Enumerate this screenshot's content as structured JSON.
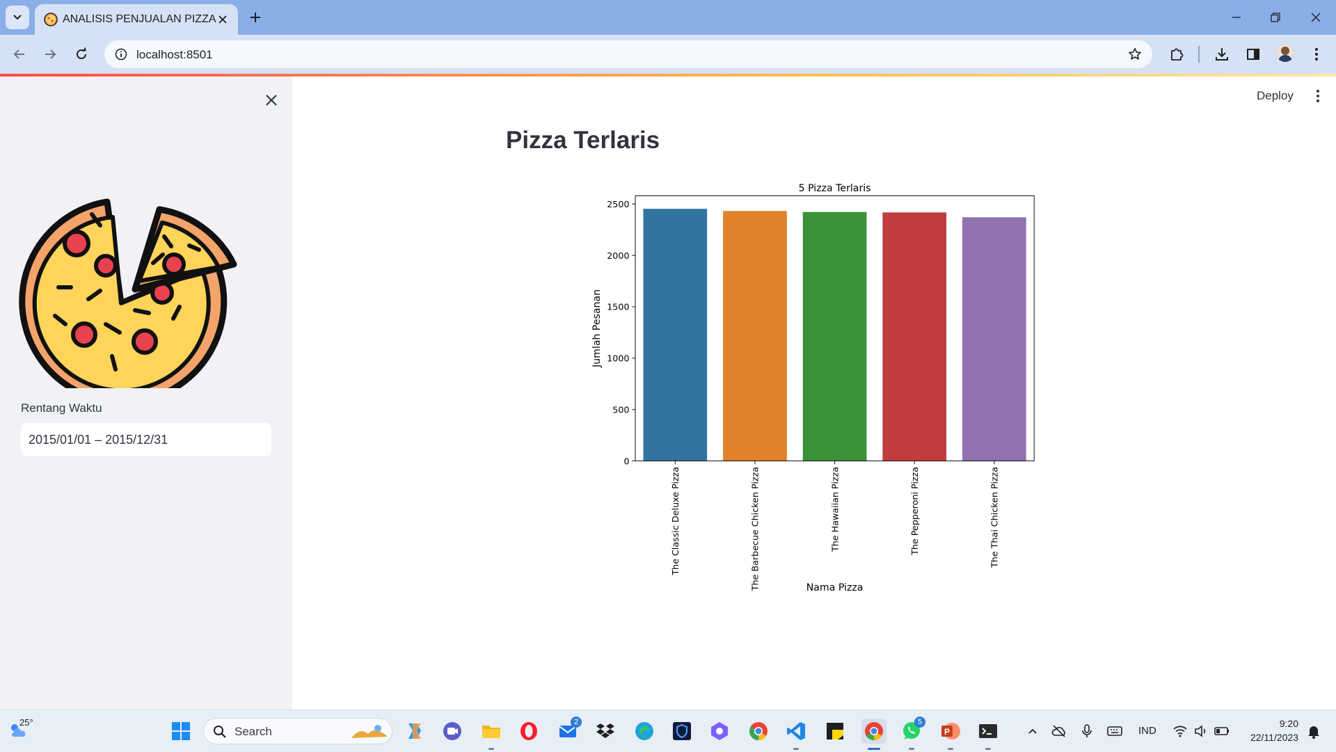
{
  "browser": {
    "tab_title": "ANALISIS PENJUALAN PIZZA",
    "url": "localhost:8501"
  },
  "sidebar": {
    "date_label": "Rentang Waktu",
    "date_value": "2015/01/01 – 2015/12/31"
  },
  "header": {
    "deploy_label": "Deploy"
  },
  "main": {
    "title": "Pizza Terlaris"
  },
  "chart_data": {
    "type": "bar",
    "title": "5 Pizza Terlaris",
    "xlabel": "Nama Pizza",
    "ylabel": "Jumlah Pesanan",
    "categories": [
      "The Classic Deluxe Pizza",
      "The Barbecue Chicken Pizza",
      "The Hawaiian Pizza",
      "The Pepperoni Pizza",
      "The Thai Chicken Pizza"
    ],
    "values": [
      2453,
      2432,
      2422,
      2418,
      2371
    ],
    "colors": [
      "#3274a1",
      "#e1812c",
      "#3a923a",
      "#c03d3e",
      "#9372b2"
    ],
    "ylim": [
      0,
      2580
    ],
    "yticks": [
      0,
      500,
      1000,
      1500,
      2000,
      2500
    ],
    "grid": false,
    "legend": "none"
  },
  "taskbar": {
    "weather_temp": "25°",
    "search_placeholder": "Search",
    "mail_badge": "2",
    "whatsapp_badge": "5",
    "language": "IND",
    "time": "9:20",
    "date": "22/11/2023"
  }
}
